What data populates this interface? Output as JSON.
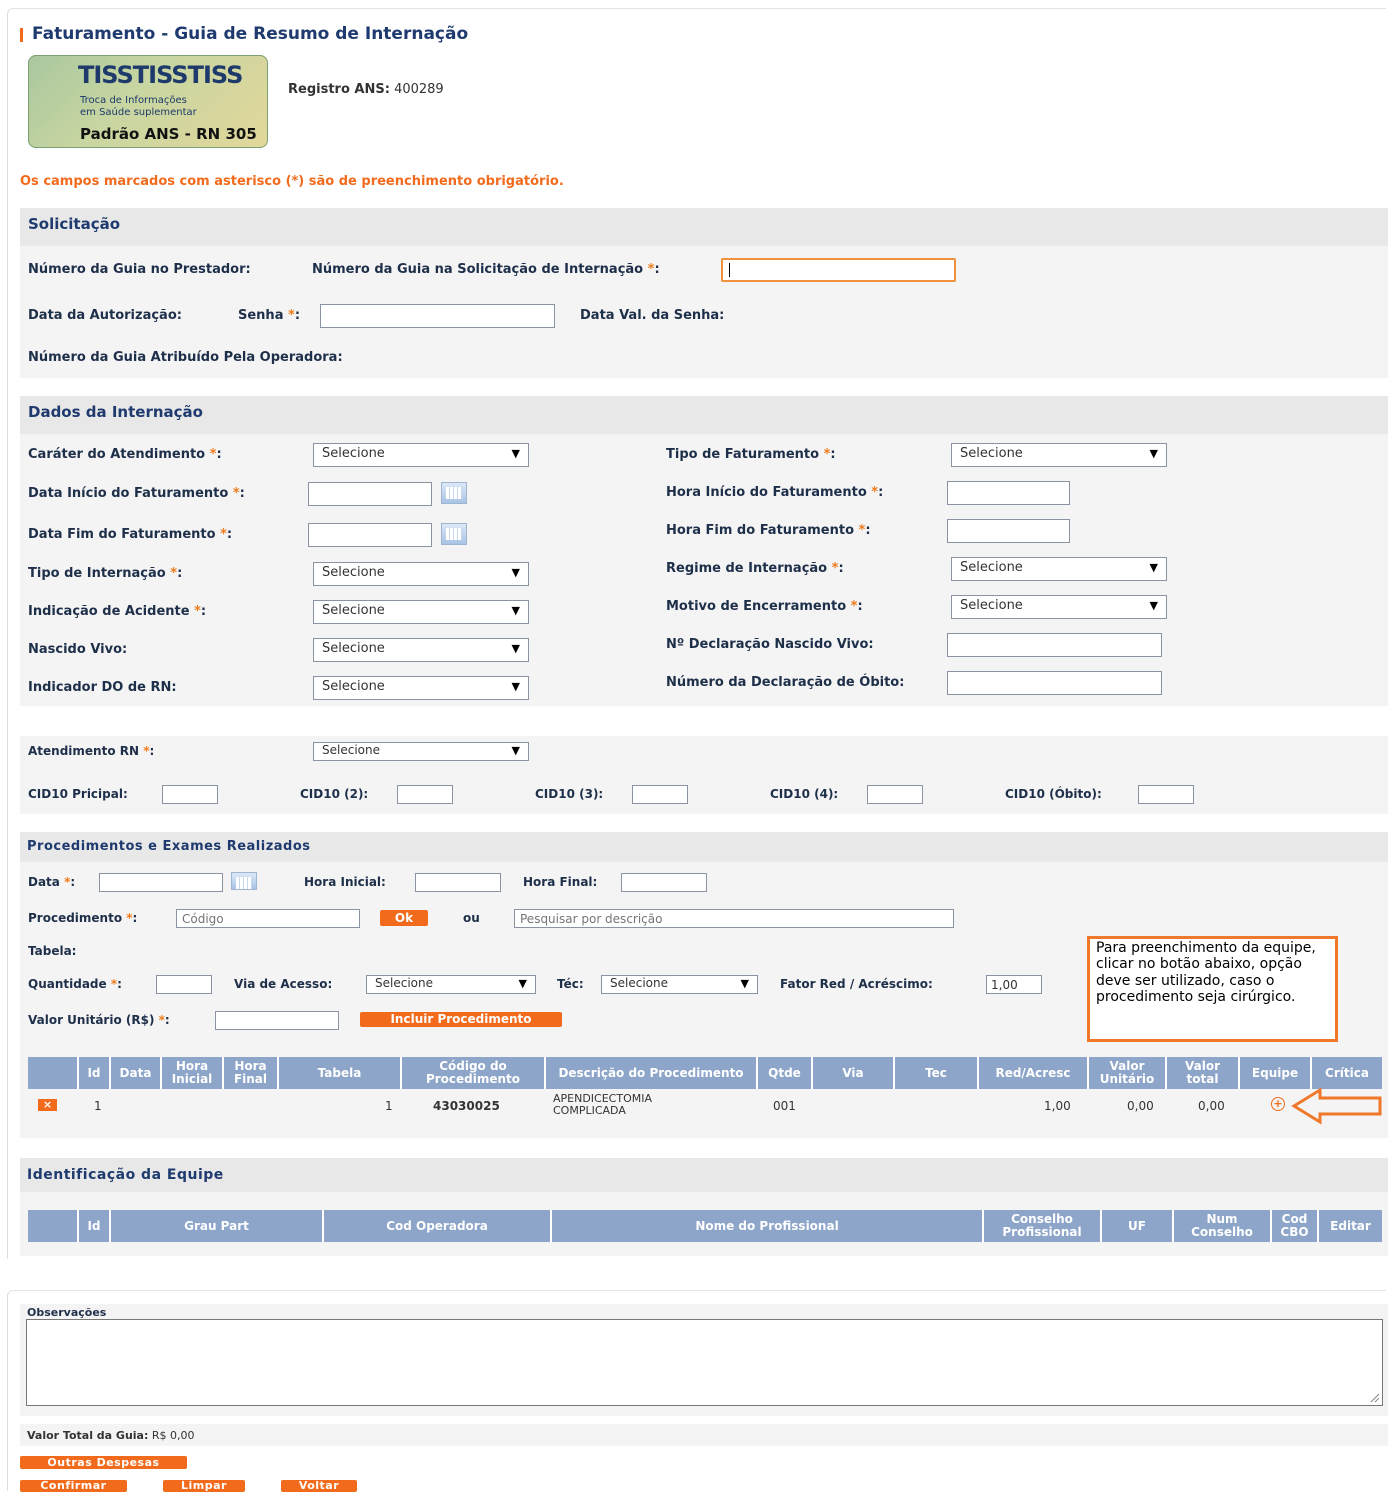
{
  "page_title": "Faturamento - Guia de Resumo de Internação",
  "logo": {
    "line1": "TISSTISSTISS",
    "line2": "Troca de Informações",
    "line3": "em Saúde suplementar",
    "line4": "Padrão ANS - RN 305"
  },
  "registro": {
    "label": "Registro ANS:",
    "value": "400289"
  },
  "mandatory_note": "Os campos marcados com asterisco (*) são de preenchimento obrigatório.",
  "solicitacao": {
    "title": "Solicitação",
    "numero_prestador": "Número da Guia no Prestador:",
    "numero_solicitacao": "Número da Guia na Solicitação de Internação",
    "data_autorizacao": "Data da Autorização:",
    "senha": "Senha",
    "data_val_senha": "Data Val. da Senha:",
    "numero_operadora": "Número da Guia Atribuído Pela Operadora:"
  },
  "internacao": {
    "title": "Dados da Internação",
    "carater": "Caráter do Atendimento",
    "data_inicio": "Data Início do Faturamento",
    "data_fim": "Data Fim do Faturamento",
    "tipo_internacao": "Tipo de Internação",
    "indicacao_acidente": "Indicação de Acidente",
    "nascido_vivo": "Nascido Vivo:",
    "indicador_do": "Indicador DO de RN:",
    "tipo_faturamento": "Tipo de Faturamento",
    "hora_inicio": "Hora Início do Faturamento",
    "hora_fim": "Hora Fim do Faturamento",
    "regime": "Regime de Internação",
    "motivo": "Motivo de Encerramento",
    "decl_nascido": "Nº Declaração Nascido Vivo:",
    "decl_obito": "Número da Declaração de Óbito:",
    "select_default": "Selecione"
  },
  "rn": {
    "atendimento": "Atendimento RN",
    "cid_principal": "CID10 Pricipal:",
    "cid2": "CID10 (2):",
    "cid3": "CID10 (3):",
    "cid4": "CID10 (4):",
    "cid_obito": "CID10 (Óbito):"
  },
  "procedimentos": {
    "title": "Procedimentos e Exames Realizados",
    "data": "Data",
    "hora_inicial": "Hora Inicial:",
    "hora_final": "Hora Final:",
    "procedimento": "Procedimento",
    "codigo_placeholder": "Código",
    "ok": "Ok",
    "ou": "ou",
    "descricao_placeholder": "Pesquisar por descrição",
    "tabela": "Tabela:",
    "quantidade": "Quantidade",
    "via_acesso": "Via de Acesso:",
    "tec": "Téc:",
    "fator": "Fator Red / Acréscimo:",
    "fator_value": "1,00",
    "valor_unitario": "Valor Unitário (R$)",
    "incluir": "Incluir Procedimento",
    "tooltip": "Para preenchimento da equipe, clicar no botão abaixo, opção deve ser utilizado, caso o procedimento seja cirúrgico.",
    "headers": [
      "Id",
      "Data",
      "Hora Inicial",
      "Hora Final",
      "Tabela",
      "Código do Procedimento",
      "Descrição do Procedimento",
      "Qtde",
      "Via",
      "Tec",
      "Red/Acresc",
      "Valor Unitário",
      "Valor total",
      "Equipe",
      "Crítica"
    ],
    "row": {
      "delete": "×",
      "id": "1",
      "tabela": "1",
      "codigo": "43030025",
      "descricao": "APENDICECTOMIA COMPLICADA",
      "qtde": "001",
      "red": "1,00",
      "unitario": "0,00",
      "total": "0,00",
      "equipe": "+"
    }
  },
  "equipe": {
    "title": "Identificação da Equipe",
    "headers": [
      "Id",
      "Grau Part",
      "Cod Operadora",
      "Nome do Profissional",
      "Conselho Profissional",
      "UF",
      "Num Conselho",
      "Cod CBO",
      "Editar"
    ]
  },
  "observacoes": "Observações",
  "valor_total": {
    "label": "Valor Total da Guia:",
    "value": "R$ 0,00"
  },
  "buttons": {
    "outras": "Outras Despesas",
    "confirmar": "Confirmar",
    "limpar": "Limpar",
    "voltar": "Voltar"
  },
  "colors": {
    "accent": "#f26b1d",
    "header": "#8da5c8",
    "title": "#1e3a6e"
  }
}
